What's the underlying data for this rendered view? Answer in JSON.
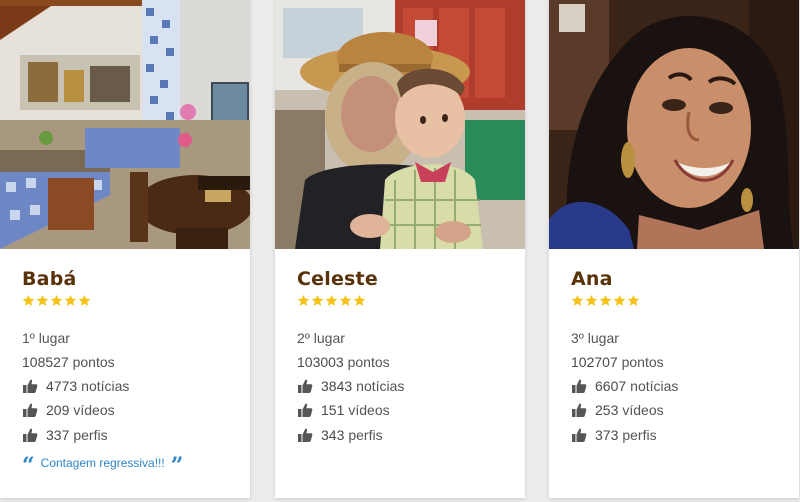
{
  "colors": {
    "name": "#5a3208",
    "star": "#f2c21a",
    "text": "#555555",
    "link": "#2f86c8",
    "thumb_icon": "#555555"
  },
  "rating_stars": 5,
  "cards": [
    {
      "name": "Babá",
      "photo": "photo-outdoor-kitchen",
      "rank_label": "1º lugar",
      "points": "108527",
      "points_label": "pontos",
      "stats": [
        {
          "value": "4773",
          "label": "notícias",
          "icon": "thumbs-up-icon"
        },
        {
          "value": "209",
          "label": "vídeos",
          "icon": "thumbs-up-icon"
        },
        {
          "value": "337",
          "label": "perfis",
          "icon": "thumbs-up-icon"
        }
      ],
      "quote": "Contagem regressiva!!!"
    },
    {
      "name": "Celeste",
      "photo": "photo-woman-with-baby",
      "rank_label": "2º lugar",
      "points": "103003",
      "points_label": "pontos",
      "stats": [
        {
          "value": "3843",
          "label": "notícias",
          "icon": "thumbs-up-icon"
        },
        {
          "value": "151",
          "label": "vídeos",
          "icon": "thumbs-up-icon"
        },
        {
          "value": "343",
          "label": "perfis",
          "icon": "thumbs-up-icon"
        }
      ]
    },
    {
      "name": "Ana",
      "photo": "photo-smiling-woman",
      "rank_label": "3º lugar",
      "points": "102707",
      "points_label": "pontos",
      "stats": [
        {
          "value": "6607",
          "label": "notícias",
          "icon": "thumbs-up-icon"
        },
        {
          "value": "253",
          "label": "vídeos",
          "icon": "thumbs-up-icon"
        },
        {
          "value": "373",
          "label": "perfis",
          "icon": "thumbs-up-icon"
        }
      ]
    }
  ]
}
